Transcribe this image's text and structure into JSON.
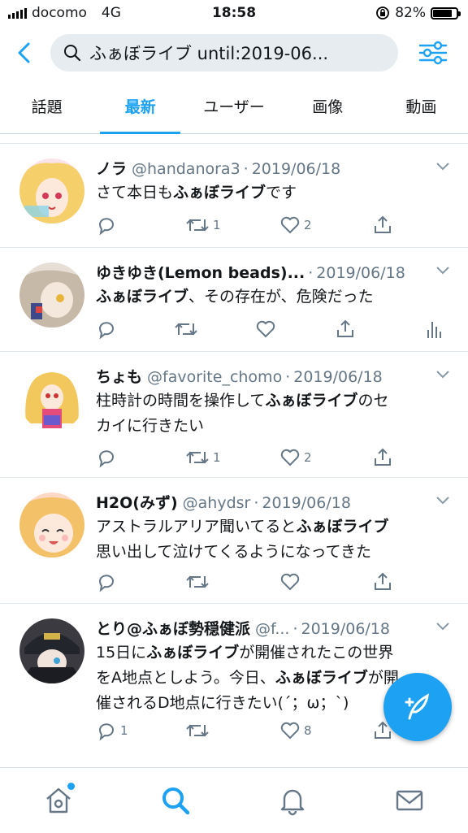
{
  "status_bar": {
    "carrier": "docomo",
    "network": "4G",
    "time": "18:58",
    "battery": "82%",
    "battery_level": 0.82
  },
  "search": {
    "query": "ふぁぼライブ until:2019-06..."
  },
  "tabs": [
    {
      "label": "話題",
      "active": false
    },
    {
      "label": "最新",
      "active": true
    },
    {
      "label": "ユーザー",
      "active": false
    },
    {
      "label": "画像",
      "active": false
    },
    {
      "label": "動画",
      "active": false
    }
  ],
  "tweets": [
    {
      "name": "ノラ",
      "handle": "@handanora3",
      "date": "2019/06/18",
      "lines": [
        [
          {
            "t": "さて本日も"
          },
          {
            "t": "ふぁぼライブ",
            "b": true
          },
          {
            "t": "です"
          }
        ]
      ],
      "replies": "",
      "retweets": "1",
      "likes": "2"
    },
    {
      "name": "ゆきゆき(Lemon beads)...",
      "handle": "",
      "date": "2019/06/18",
      "lines": [
        [
          {
            "t": "ふぁぼライブ",
            "b": true
          },
          {
            "t": "、その存在が、危険だった"
          }
        ]
      ],
      "replies": "",
      "retweets": "",
      "likes": ""
    },
    {
      "name": "ちょも",
      "handle": "@favorite_chomo",
      "date": "2019/06/18",
      "lines": [
        [
          {
            "t": "柱時計の時間を操作して"
          },
          {
            "t": "ふぁぼライブ",
            "b": true
          },
          {
            "t": "のセ"
          }
        ],
        [
          {
            "t": "カイに行きたい"
          }
        ]
      ],
      "replies": "",
      "retweets": "1",
      "likes": "2"
    },
    {
      "name": "H2O(みず)",
      "handle": "@ahydsr",
      "date": "2019/06/18",
      "lines": [
        [
          {
            "t": "アストラルアリア聞いてると"
          },
          {
            "t": "ふぁぼライブ",
            "b": true
          }
        ],
        [
          {
            "t": "思い出して泣けてくるようになってきた"
          }
        ]
      ],
      "replies": "",
      "retweets": "",
      "likes": ""
    },
    {
      "name": "とり@ふぁぼ勢穏健派",
      "handle": "@f...",
      "date": "2019/06/18",
      "lines": [
        [
          {
            "t": "15日に"
          },
          {
            "t": "ふぁぼライブ",
            "b": true
          },
          {
            "t": "が開催されたこの世界"
          }
        ],
        [
          {
            "t": "をA地点としよう。今日、"
          },
          {
            "t": "ふぁぼライブ",
            "b": true
          },
          {
            "t": "が開"
          }
        ],
        [
          {
            "t": "催されるD地点に行きたい(´；ω；`)"
          }
        ]
      ],
      "replies": "1",
      "retweets": "",
      "likes": "8"
    }
  ],
  "colors": {
    "accent": "#1da1f2",
    "secondary_text": "#657786"
  }
}
